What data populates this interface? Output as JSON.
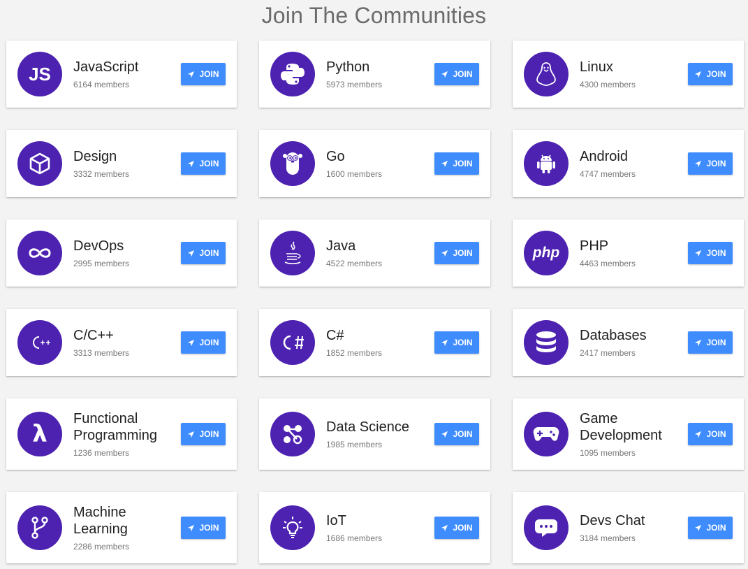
{
  "page": {
    "title": "Join The Communities"
  },
  "join_label": "JOIN",
  "colors": {
    "avatar": "#4d22b1",
    "join_button": "#3f8cff"
  },
  "communities": [
    {
      "name": "JavaScript",
      "members": "6164 members",
      "icon": "javascript-icon"
    },
    {
      "name": "Python",
      "members": "5973 members",
      "icon": "python-icon"
    },
    {
      "name": "Linux",
      "members": "4300 members",
      "icon": "linux-icon"
    },
    {
      "name": "Design",
      "members": "3332 members",
      "icon": "cube-icon"
    },
    {
      "name": "Go",
      "members": "1600 members",
      "icon": "gopher-icon"
    },
    {
      "name": "Android",
      "members": "4747 members",
      "icon": "android-icon"
    },
    {
      "name": "DevOps",
      "members": "2995 members",
      "icon": "infinity-icon"
    },
    {
      "name": "Java",
      "members": "4522 members",
      "icon": "java-cup-icon"
    },
    {
      "name": "PHP",
      "members": "4463 members",
      "icon": "php-icon"
    },
    {
      "name": "C/C++",
      "members": "3313 members",
      "icon": "cpp-icon"
    },
    {
      "name": "C#",
      "members": "1852 members",
      "icon": "csharp-icon"
    },
    {
      "name": "Databases",
      "members": "2417 members",
      "icon": "database-icon"
    },
    {
      "name": "Functional Programming",
      "members": "1236 members",
      "icon": "lambda-icon"
    },
    {
      "name": "Data Science",
      "members": "1985 members",
      "icon": "molecule-icon"
    },
    {
      "name": "Game Development",
      "members": "1095 members",
      "icon": "gamepad-icon"
    },
    {
      "name": "Machine Learning",
      "members": "2286 members",
      "icon": "source-branch-icon"
    },
    {
      "name": "IoT",
      "members": "1686 members",
      "icon": "lightbulb-icon"
    },
    {
      "name": "Devs Chat",
      "members": "3184 members",
      "icon": "chat-bubble-icon"
    }
  ]
}
